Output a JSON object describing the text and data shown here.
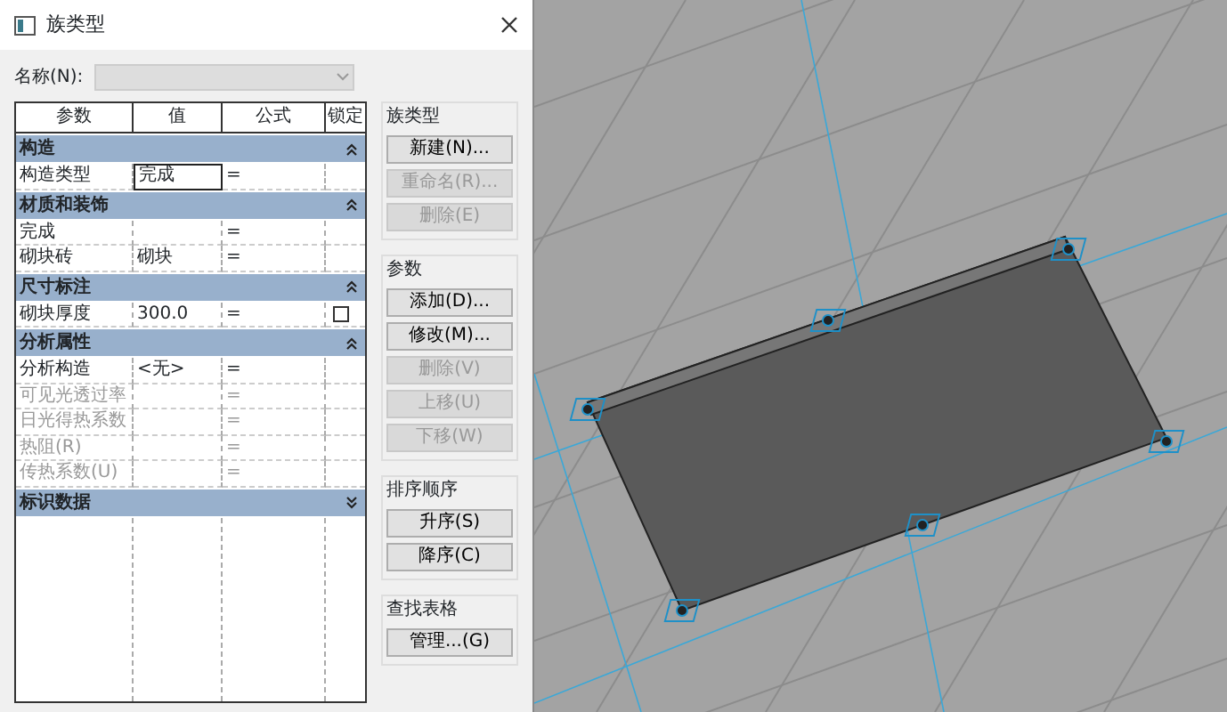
{
  "window": {
    "title": "族类型"
  },
  "name_field": {
    "label": "名称(N):",
    "disabled": true
  },
  "table": {
    "columns": [
      "参数",
      "值",
      "公式",
      "锁定"
    ],
    "groups": [
      {
        "name": "构造",
        "expanded": true,
        "rows": [
          {
            "param": "构造类型",
            "value": "完成",
            "formula": "=",
            "disabled": false,
            "selected": true,
            "lockable": false
          }
        ]
      },
      {
        "name": "材质和装饰",
        "expanded": true,
        "rows": [
          {
            "param": "完成",
            "formula": "=",
            "disabled": false,
            "selected": false,
            "lockable": false
          },
          {
            "param": "砌块砖",
            "value": "砌块",
            "formula": "=",
            "disabled": false,
            "selected": false,
            "lockable": false
          }
        ]
      },
      {
        "name": "尺寸标注",
        "expanded": true,
        "rows": [
          {
            "param": "砌块厚度",
            "value": "300.0",
            "formula": "=",
            "disabled": false,
            "selected": false,
            "lockable": true,
            "locked": false
          }
        ]
      },
      {
        "name": "分析属性",
        "expanded": true,
        "rows": [
          {
            "param": "分析构造",
            "value": "<无>",
            "formula": "=",
            "disabled": false,
            "selected": false,
            "lockable": false
          },
          {
            "param": "可见光透过率",
            "formula": "=",
            "disabled": true,
            "selected": false,
            "lockable": false
          },
          {
            "param": "日光得热系数",
            "formula": "=",
            "disabled": true,
            "selected": false,
            "lockable": false
          },
          {
            "param": "热阻(R)",
            "formula": "=",
            "disabled": true,
            "selected": false,
            "lockable": false
          },
          {
            "param": "传热系数(U)",
            "formula": "=",
            "disabled": true,
            "selected": false,
            "lockable": false
          }
        ]
      },
      {
        "name": "标识数据",
        "expanded": false
      }
    ]
  },
  "sections": [
    {
      "title": "族类型",
      "buttons": [
        {
          "label": "新建(N)...",
          "disabled": false
        },
        {
          "label": "重命名(R)...",
          "disabled": true
        },
        {
          "label": "删除(E)",
          "disabled": true
        }
      ]
    },
    {
      "title": "参数",
      "buttons": [
        {
          "label": "添加(D)...",
          "disabled": false
        },
        {
          "label": "修改(M)...",
          "disabled": false
        },
        {
          "label": "删除(V)",
          "disabled": true
        },
        {
          "label": "上移(U)",
          "disabled": true
        },
        {
          "label": "下移(W)",
          "disabled": true
        }
      ]
    },
    {
      "title": "排序顺序",
      "buttons": [
        {
          "label": "升序(S)",
          "disabled": false
        },
        {
          "label": "降序(C)",
          "disabled": false
        }
      ]
    },
    {
      "title": "查找表格",
      "buttons": [
        {
          "label": "管理...(G)",
          "disabled": false
        }
      ]
    }
  ]
}
